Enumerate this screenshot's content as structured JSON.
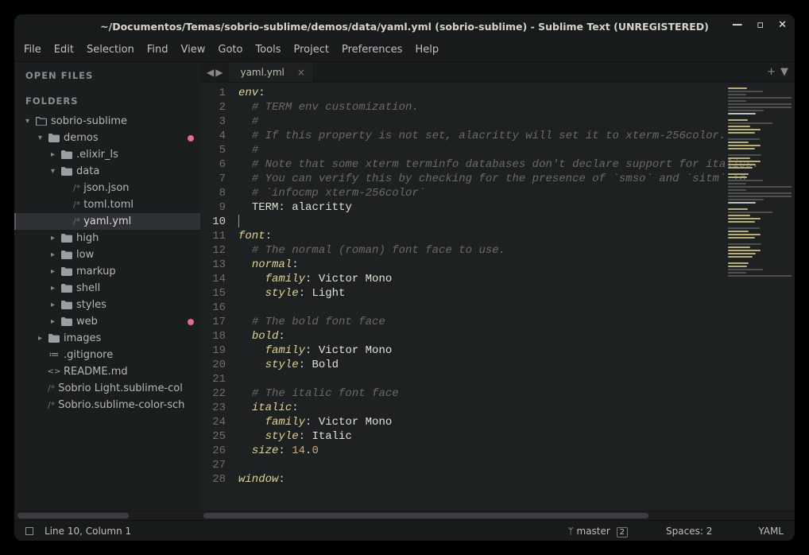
{
  "titlebar": {
    "title": "~/Documentos/Temas/sobrio-sublime/demos/data/yaml.yml (sobrio-sublime) - Sublime Text (UNREGISTERED)"
  },
  "menubar": {
    "items": [
      "File",
      "Edit",
      "Selection",
      "Find",
      "View",
      "Goto",
      "Tools",
      "Project",
      "Preferences",
      "Help"
    ]
  },
  "sidebar": {
    "open_files_title": "OPEN FILES",
    "folders_title": "FOLDERS",
    "tree": [
      {
        "indent": 0,
        "chev": "▾",
        "kind": "folder-open",
        "label": "sobrio-sublime"
      },
      {
        "indent": 1,
        "chev": "▾",
        "kind": "folder-solid",
        "label": "demos",
        "dot": true
      },
      {
        "indent": 2,
        "chev": "▸",
        "kind": "folder-solid",
        "label": ".elixir_ls"
      },
      {
        "indent": 2,
        "chev": "▾",
        "kind": "folder-solid",
        "label": "data"
      },
      {
        "indent": 3,
        "chev": "",
        "kind": "ext",
        "ext": "/*",
        "label": "json.json"
      },
      {
        "indent": 3,
        "chev": "",
        "kind": "ext",
        "ext": "/*",
        "label": "toml.toml"
      },
      {
        "indent": 3,
        "chev": "",
        "kind": "ext",
        "ext": "/*",
        "label": "yaml.yml",
        "selected": true
      },
      {
        "indent": 2,
        "chev": "▸",
        "kind": "folder-solid",
        "label": "high"
      },
      {
        "indent": 2,
        "chev": "▸",
        "kind": "folder-solid",
        "label": "low"
      },
      {
        "indent": 2,
        "chev": "▸",
        "kind": "folder-solid",
        "label": "markup"
      },
      {
        "indent": 2,
        "chev": "▸",
        "kind": "folder-solid",
        "label": "shell"
      },
      {
        "indent": 2,
        "chev": "▸",
        "kind": "folder-solid",
        "label": "styles"
      },
      {
        "indent": 2,
        "chev": "▸",
        "kind": "folder-solid",
        "label": "web",
        "dot": true
      },
      {
        "indent": 1,
        "chev": "▸",
        "kind": "folder-solid",
        "label": "images"
      },
      {
        "indent": 1,
        "chev": "",
        "kind": "gitignore",
        "label": ".gitignore"
      },
      {
        "indent": 1,
        "chev": "",
        "kind": "md",
        "label": "README.md"
      },
      {
        "indent": 1,
        "chev": "",
        "kind": "ext",
        "ext": "/*",
        "label": "Sobrio Light.sublime-col"
      },
      {
        "indent": 1,
        "chev": "",
        "kind": "ext",
        "ext": "/*",
        "label": "Sobrio.sublime-color-sch"
      }
    ]
  },
  "tabs": {
    "open": [
      {
        "label": "yaml.yml",
        "active": true
      }
    ]
  },
  "editor": {
    "active_line": 10,
    "lines": [
      [
        {
          "t": "key",
          "v": "env"
        },
        {
          "t": "colon",
          "v": ":"
        }
      ],
      [
        {
          "t": "pad",
          "v": "  "
        },
        {
          "t": "comment",
          "v": "# TERM env customization."
        }
      ],
      [
        {
          "t": "pad",
          "v": "  "
        },
        {
          "t": "comment",
          "v": "#"
        }
      ],
      [
        {
          "t": "pad",
          "v": "  "
        },
        {
          "t": "comment",
          "v": "# If this property is not set, alacritty will set it to xterm-256color."
        }
      ],
      [
        {
          "t": "pad",
          "v": "  "
        },
        {
          "t": "comment",
          "v": "#"
        }
      ],
      [
        {
          "t": "pad",
          "v": "  "
        },
        {
          "t": "comment",
          "v": "# Note that some xterm terminfo databases don't declare support for italics."
        }
      ],
      [
        {
          "t": "pad",
          "v": "  "
        },
        {
          "t": "comment",
          "v": "# You can verify this by checking for the presence of `smso` and `sitm` in"
        }
      ],
      [
        {
          "t": "pad",
          "v": "  "
        },
        {
          "t": "comment",
          "v": "# `infocmp xterm-256color`"
        }
      ],
      [
        {
          "t": "pad",
          "v": "  "
        },
        {
          "t": "var",
          "v": "TERM"
        },
        {
          "t": "colon",
          "v": ": "
        },
        {
          "t": "val",
          "v": "alacritty"
        }
      ],
      [
        {
          "t": "cursor",
          "v": ""
        }
      ],
      [
        {
          "t": "key",
          "v": "font"
        },
        {
          "t": "colon",
          "v": ":"
        }
      ],
      [
        {
          "t": "pad",
          "v": "  "
        },
        {
          "t": "comment",
          "v": "# The normal (roman) font face to use."
        }
      ],
      [
        {
          "t": "pad",
          "v": "  "
        },
        {
          "t": "key",
          "v": "normal"
        },
        {
          "t": "colon",
          "v": ":"
        }
      ],
      [
        {
          "t": "pad",
          "v": "    "
        },
        {
          "t": "key",
          "v": "family"
        },
        {
          "t": "colon",
          "v": ": "
        },
        {
          "t": "val",
          "v": "Victor Mono"
        }
      ],
      [
        {
          "t": "pad",
          "v": "    "
        },
        {
          "t": "key",
          "v": "style"
        },
        {
          "t": "colon",
          "v": ": "
        },
        {
          "t": "val",
          "v": "Light"
        }
      ],
      [],
      [
        {
          "t": "pad",
          "v": "  "
        },
        {
          "t": "comment",
          "v": "# The bold font face"
        }
      ],
      [
        {
          "t": "pad",
          "v": "  "
        },
        {
          "t": "key",
          "v": "bold"
        },
        {
          "t": "colon",
          "v": ":"
        }
      ],
      [
        {
          "t": "pad",
          "v": "    "
        },
        {
          "t": "key",
          "v": "family"
        },
        {
          "t": "colon",
          "v": ": "
        },
        {
          "t": "val",
          "v": "Victor Mono"
        }
      ],
      [
        {
          "t": "pad",
          "v": "    "
        },
        {
          "t": "key",
          "v": "style"
        },
        {
          "t": "colon",
          "v": ": "
        },
        {
          "t": "val",
          "v": "Bold"
        }
      ],
      [],
      [
        {
          "t": "pad",
          "v": "  "
        },
        {
          "t": "comment",
          "v": "# The italic font face"
        }
      ],
      [
        {
          "t": "pad",
          "v": "  "
        },
        {
          "t": "key",
          "v": "italic"
        },
        {
          "t": "colon",
          "v": ":"
        }
      ],
      [
        {
          "t": "pad",
          "v": "    "
        },
        {
          "t": "key",
          "v": "family"
        },
        {
          "t": "colon",
          "v": ": "
        },
        {
          "t": "val",
          "v": "Victor Mono"
        }
      ],
      [
        {
          "t": "pad",
          "v": "    "
        },
        {
          "t": "key",
          "v": "style"
        },
        {
          "t": "colon",
          "v": ": "
        },
        {
          "t": "val",
          "v": "Italic"
        }
      ],
      [
        {
          "t": "pad",
          "v": "  "
        },
        {
          "t": "key",
          "v": "size"
        },
        {
          "t": "colon",
          "v": ": "
        },
        {
          "t": "num",
          "v": "14"
        },
        {
          "t": "colon",
          "v": "."
        },
        {
          "t": "num",
          "v": "0"
        }
      ],
      [],
      [
        {
          "t": "key",
          "v": "window"
        },
        {
          "t": "colon",
          "v": ":"
        }
      ]
    ]
  },
  "statusbar": {
    "position": "Line 10, Column 1",
    "branch": "master",
    "branch_count": "2",
    "spaces": "Spaces: 2",
    "syntax": "YAML"
  }
}
